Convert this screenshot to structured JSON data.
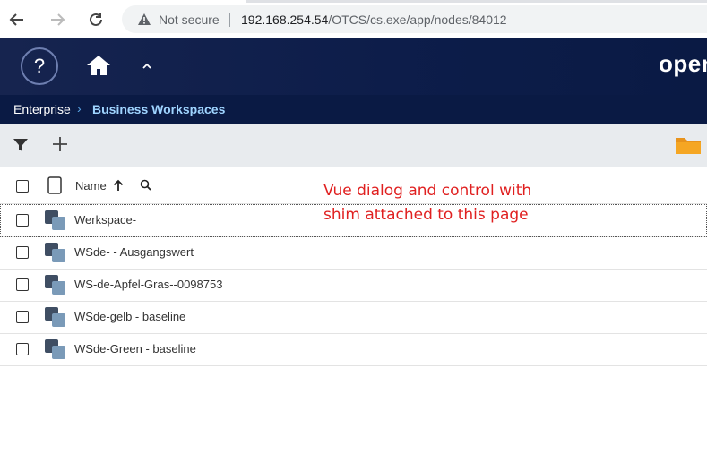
{
  "browser": {
    "security_label": "Not secure",
    "url_host": "192.168.254.54",
    "url_path": "/OTCS/cs.exe/app/nodes/84012"
  },
  "header": {
    "help_label": "?",
    "brand_text": "open"
  },
  "breadcrumb": {
    "items": [
      {
        "label": "Enterprise"
      },
      {
        "label": "Business Workspaces"
      }
    ],
    "separator": "›"
  },
  "table": {
    "name_column": "Name",
    "sort_direction": "ascending",
    "rows": [
      {
        "name": "Werkspace-"
      },
      {
        "name": "WSde- - Ausgangswert"
      },
      {
        "name": "WS-de-Apfel-Gras--0098753"
      },
      {
        "name": "WSde-gelb - baseline"
      },
      {
        "name": "WSde-Green - baseline"
      }
    ]
  },
  "annotation": {
    "line1": "Vue dialog and control with",
    "line2": "shim attached to this page"
  },
  "colors": {
    "header_bg": "#0d1d4a",
    "breadcrumb_active": "#9fd4ff",
    "annotation": "#e02020",
    "folder": "#e8931c"
  }
}
